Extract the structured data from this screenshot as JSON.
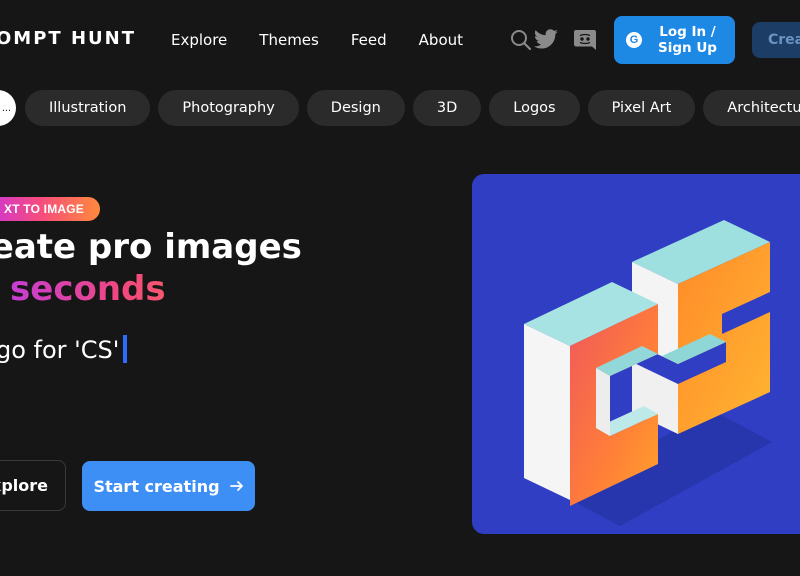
{
  "header": {
    "brand": "OMPT HUNT",
    "nav": [
      "Explore",
      "Themes",
      "Feed",
      "About"
    ],
    "login_label": "Log In /\nSign Up",
    "create_label": "Crea"
  },
  "icons": {
    "search": "search-icon",
    "twitter": "twitter-icon",
    "discord": "discord-icon",
    "google": "google-icon",
    "arrow": "arrow-right-icon"
  },
  "categories": {
    "more_label": "...",
    "items": [
      "Illustration",
      "Photography",
      "Design",
      "3D",
      "Logos",
      "Pixel Art",
      "Architecture"
    ]
  },
  "hero": {
    "badge": "XT TO IMAGE",
    "title_line1": "reate pro images",
    "title_line2": "n seconds",
    "typed_text": "go for 'CS'",
    "explore_label": "xplore",
    "start_label": "Start creating"
  },
  "colors": {
    "background": "#161616",
    "primary": "#1e88e5",
    "start_button": "#3d8ff5",
    "chip": "#2b2b2b",
    "hero_image_bg": "#2f3ec2"
  }
}
